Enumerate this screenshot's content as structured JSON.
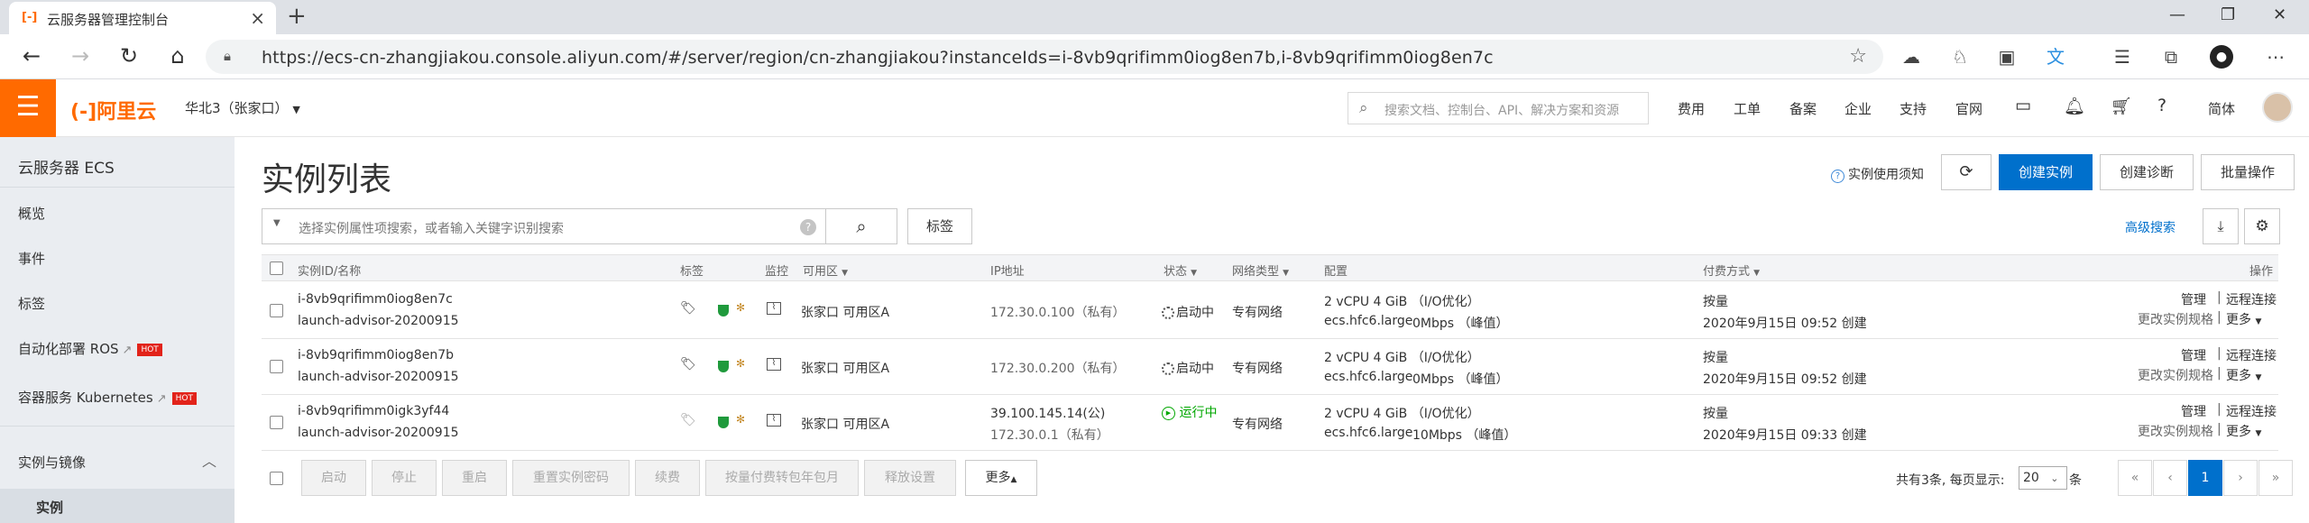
{
  "browser": {
    "tab_title": "云服务器管理控制台",
    "tab_icon": "[-]",
    "url": "https://ecs-cn-zhangjiakou.console.aliyun.com/#/server/region/cn-zhangjiakou?instanceIds=i-8vb9qrifimm0iog8en7b,i-8vb9qrifimm0iog8en7c"
  },
  "header": {
    "logo": "(-]阿里云",
    "region": "华北3（张家口）",
    "search_placeholder": "搜索文档、控制台、API、解决方案和资源",
    "nav": [
      "费用",
      "工单",
      "备案",
      "企业",
      "支持",
      "官网"
    ],
    "lang": "简体"
  },
  "sidebar": {
    "title": "云服务器 ECS",
    "items": [
      {
        "label": "概览"
      },
      {
        "label": "事件"
      },
      {
        "label": "标签"
      },
      {
        "label": "自动化部署 ROS",
        "hot": "HOT"
      },
      {
        "label": "容器服务 Kubernetes",
        "hot": "HOT"
      }
    ],
    "group": "实例与镜像",
    "active": "实例"
  },
  "main": {
    "title": "实例列表",
    "help": "实例使用须知",
    "buttons": {
      "create": "创建实例",
      "diagnose": "创建诊断",
      "batch": "批量操作",
      "tag": "标签",
      "advanced": "高级搜索"
    },
    "filter_placeholder": "选择实例属性项搜索，或者输入关键字识别搜索"
  },
  "table": {
    "headers": [
      "实例ID/名称",
      "标签",
      "监控",
      "可用区",
      "IP地址",
      "状态",
      "网络类型",
      "配置",
      "付费方式",
      "操作"
    ],
    "rows": [
      {
        "id": "i-8vb9qrifimm0iog8en7c",
        "name": "launch-advisor-20200915",
        "zone": "张家口 可用区A",
        "ip1": "172.30.0.100（私有）",
        "ip2": "",
        "status": "启动中",
        "network": "专有网络",
        "cfg1": "2 vCPU 4 GiB （I/O优化）",
        "cfg_type": "ecs.hfc6.large",
        "bandwidth": "0Mbps （峰值）",
        "pay": "按量",
        "created": "2020年9月15日 09:52 创建",
        "ops1": "管理",
        "ops2": "远程连接",
        "ops3": "更改实例规格",
        "ops4": "更多"
      },
      {
        "id": "i-8vb9qrifimm0iog8en7b",
        "name": "launch-advisor-20200915",
        "zone": "张家口 可用区A",
        "ip1": "172.30.0.200（私有）",
        "ip2": "",
        "status": "启动中",
        "network": "专有网络",
        "cfg1": "2 vCPU 4 GiB （I/O优化）",
        "cfg_type": "ecs.hfc6.large",
        "bandwidth": "0Mbps （峰值）",
        "pay": "按量",
        "created": "2020年9月15日 09:52 创建",
        "ops1": "管理",
        "ops2": "远程连接",
        "ops3": "更改实例规格",
        "ops4": "更多"
      },
      {
        "id": "i-8vb9qrifimm0igk3yf44",
        "name": "launch-advisor-20200915",
        "zone": "张家口 可用区A",
        "ip1": "39.100.145.14(公)",
        "ip2": "172.30.0.1（私有）",
        "status": "运行中",
        "network": "专有网络",
        "cfg1": "2 vCPU 4 GiB （I/O优化）",
        "cfg_type": "ecs.hfc6.large",
        "bandwidth": "10Mbps （峰值）",
        "pay": "按量",
        "created": "2020年9月15日 09:33 创建",
        "ops1": "管理",
        "ops2": "远程连接",
        "ops3": "更改实例规格",
        "ops4": "更多"
      }
    ]
  },
  "footer": {
    "actions": [
      "启动",
      "停止",
      "重启",
      "重置实例密码",
      "续费",
      "按量付费转包年包月",
      "释放设置",
      "更多"
    ],
    "total": "共有3条, 每页显示:",
    "page_size": "20",
    "unit": "条",
    "current_page": "1"
  }
}
